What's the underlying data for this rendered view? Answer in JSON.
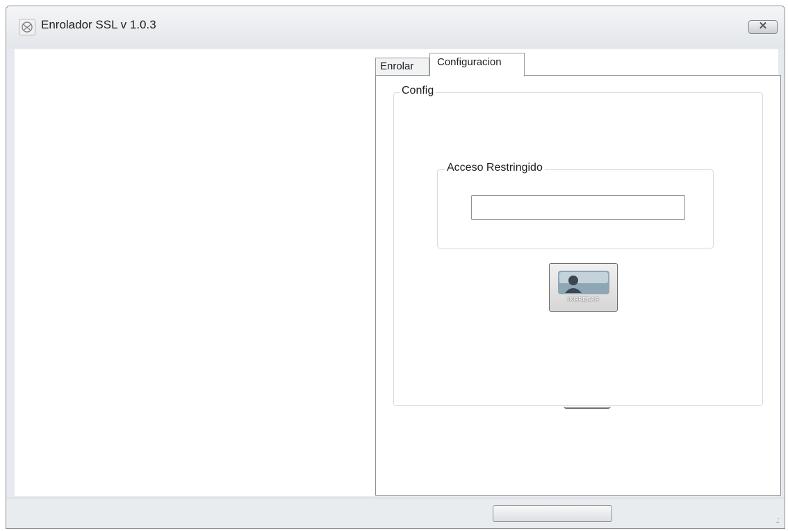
{
  "window": {
    "title": "Enrolador SSL v 1.0.3",
    "close_icon": "close-icon",
    "close_glyph": "✕"
  },
  "tabs": [
    {
      "label": "Enrolar",
      "selected": false
    },
    {
      "label": "Configuracion",
      "selected": true
    }
  ],
  "config_group": {
    "label": "Config"
  },
  "access_group": {
    "label": "Acceso Restringido",
    "password_value": "",
    "password_placeholder": ""
  },
  "ingresar_button": {
    "label": "INGRESAR",
    "icon": "user-card-icon"
  },
  "statusbar": {
    "grip_glyph": ".:"
  },
  "colors": {
    "window_frame": "#e6e9ed",
    "border": "#8f8f8f",
    "groupbox_border": "#d5dbe1"
  }
}
